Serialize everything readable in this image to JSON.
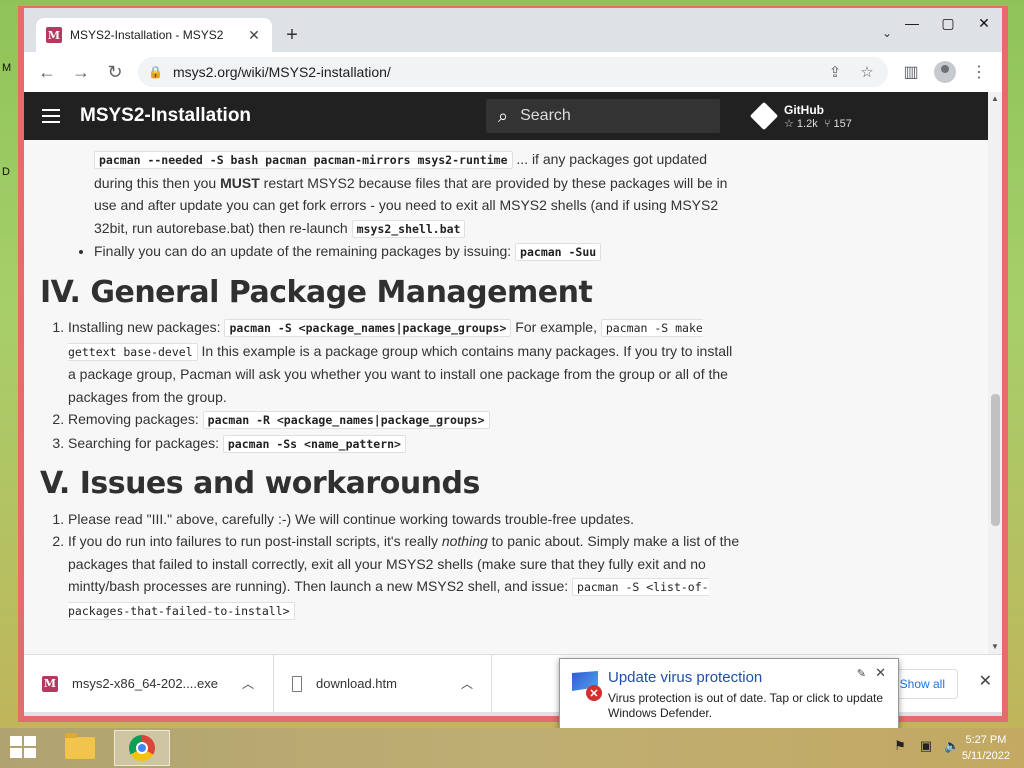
{
  "desktop": {
    "label_m": "M",
    "label_d": "D"
  },
  "browser": {
    "tab_title": "MSYS2-Installation - MSYS2",
    "tab_favicon": "M",
    "url": "msys2.org/wiki/MSYS2-installation/"
  },
  "site": {
    "title": "MSYS2-Installation",
    "search_placeholder": "Search",
    "github_label": "GitHub",
    "github_stars": "1.2k",
    "github_forks": "157"
  },
  "content": {
    "p1_code1": "pacman --needed -S bash pacman pacman-mirrors msys2-runtime",
    "p1_t1": " ... if any packages got updated during this then you ",
    "p1_bold": "MUST",
    "p1_t2": " restart MSYS2 because files that are provided by these packages will be in use and after update you can get fork errors - you need to exit all MSYS2 shells (and if using MSYS2 32bit, run autorebase.bat) then re-launch ",
    "p1_code2": "msys2_shell.bat",
    "p2_t": "Finally you can do an update of the remaining packages by issuing: ",
    "p2_code": "pacman -Suu",
    "h4": "IV. General Package Management",
    "s4_1_t1": "Installing new packages: ",
    "s4_1_code1": "pacman -S <package_names|package_groups>",
    "s4_1_t2": " For example, ",
    "s4_1_code2": "pacman -S make gettext base-devel",
    "s4_1_t3": " In this example is a package group which contains many packages. If you try to install a package group, Pacman will ask you whether you want to install one package from the group or all of the packages from the group.",
    "s4_2_t": "Removing packages: ",
    "s4_2_code": "pacman -R <package_names|package_groups>",
    "s4_3_t": "Searching for packages: ",
    "s4_3_code": "pacman -Ss <name_pattern>",
    "h5": "V. Issues and workarounds",
    "s5_1": "Please read \"III.\" above, carefully :-) We will continue working towards trouble-free updates.",
    "s5_2_t1": "If you do run into failures to run post-install scripts, it's really ",
    "s5_2_em": "nothing",
    "s5_2_t2": " to panic about. Simply make a list of the packages that failed to install correctly, exit all your MSYS2 shells (make sure that they fully exit and no mintty/bash processes are running). Then launch a new MSYS2 shell, and issue: ",
    "s5_2_code": "pacman -S <list-of-packages-that-failed-to-install>"
  },
  "downloads": {
    "item1": "msys2-x86_64-202....exe",
    "item2": "download.htm",
    "show_all": "Show all"
  },
  "toast": {
    "title": "Update virus protection",
    "body": "Virus protection is out of date. Tap or click to update Windows Defender."
  },
  "taskbar": {
    "time": "5:27 PM",
    "date": "5/11/2022"
  },
  "colors": {
    "window_border": "#e46c6c",
    "site_header": "#212121",
    "link_blue": "#1a73e8"
  }
}
